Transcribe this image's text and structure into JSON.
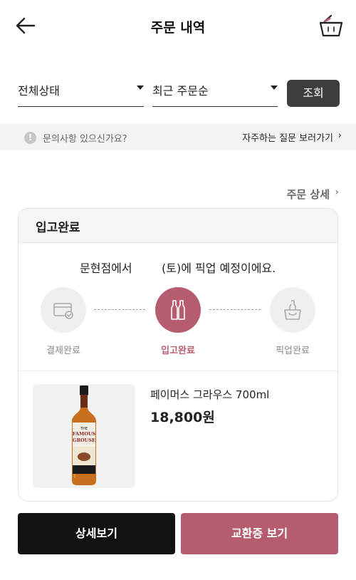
{
  "header": {
    "title": "주문 내역",
    "back_icon": "back-arrow-icon",
    "basket_icon": "basket-icon"
  },
  "filters": {
    "status": {
      "value": "전체상태"
    },
    "sort": {
      "value": "최근 주문순"
    },
    "search_label": "조회"
  },
  "inquiry": {
    "icon": "!",
    "text": "문의사항 있으신가요?",
    "faq_link": "자주하는 질문 보러가기",
    "chevron": "›"
  },
  "order": {
    "detail_link": "주문 상세",
    "chevron": "›",
    "status_title": "입고완료",
    "pickup_store": "문현점에서",
    "pickup_message": "(토)에 픽업 예정이에요.",
    "steps": [
      {
        "label": "결제완료",
        "icon": "card-check-icon",
        "active": false
      },
      {
        "label": "입고완료",
        "icon": "bottles-icon",
        "active": true
      },
      {
        "label": "픽업완료",
        "icon": "pickup-bag-icon",
        "active": false
      }
    ],
    "product": {
      "name": "페이머스 그라우스 700ml",
      "price": "18,800원",
      "image_label_1": "THE",
      "image_label_2": "FAMOUS",
      "image_label_3": "GROUSE"
    }
  },
  "actions": {
    "detail_button": "상세보기",
    "voucher_button": "교환증 보기"
  },
  "colors": {
    "accent": "#b55d6f",
    "dark_button": "#121212",
    "search_button": "#3d3d3d"
  }
}
